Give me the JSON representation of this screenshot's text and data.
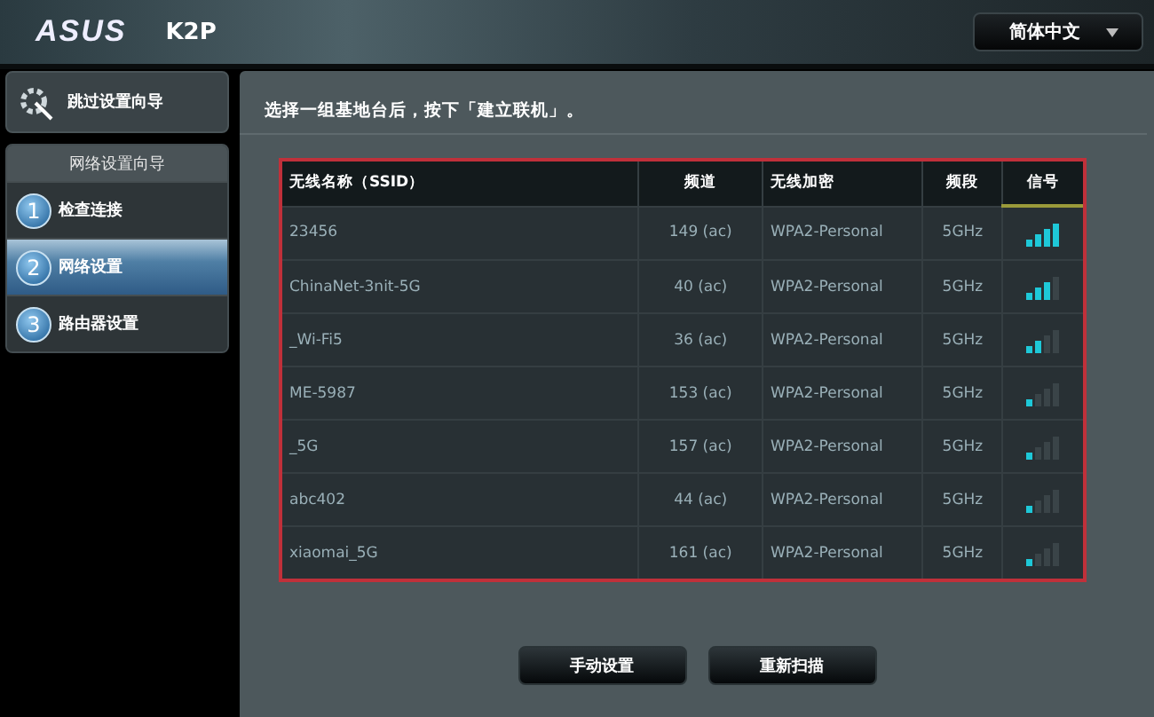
{
  "header": {
    "logo": "ASUS",
    "model": "K2P",
    "language": "简体中文"
  },
  "sidebar": {
    "skip_item": "跳过设置向导",
    "wizard_title": "网络设置向导",
    "steps": [
      {
        "number": "1",
        "label": "检查连接",
        "selected": false
      },
      {
        "number": "2",
        "label": "网络设置",
        "selected": true
      },
      {
        "number": "3",
        "label": "路由器设置",
        "selected": false
      }
    ]
  },
  "instruction": "选择一组基地台后，按下「建立联机」。",
  "table": {
    "columns": [
      "无线名称（SSID）",
      "频道",
      "无线加密",
      "频段",
      "信号"
    ],
    "rows": [
      {
        "ssid": "23456",
        "channel": "149 (ac)",
        "encryption": "WPA2-Personal",
        "band": "5GHz",
        "kind": "excellent"
      },
      {
        "ssid": "ChinaNet-3nit-5G",
        "channel": "40 (ac)",
        "encryption": "WPA2-Personal",
        "band": "5GHz",
        "kind": "good"
      },
      {
        "ssid": "_Wi-Fi5",
        "channel": "36 (ac)",
        "encryption": "WPA2-Personal",
        "band": "5GHz",
        "kind": "fair"
      },
      {
        "ssid": "ME-5987",
        "channel": "153 (ac)",
        "encryption": "WPA2-Personal",
        "band": "5GHz",
        "kind": "weak"
      },
      {
        "ssid": "_5G",
        "channel": "157 (ac)",
        "encryption": "WPA2-Personal",
        "band": "5GHz",
        "kind": "weak"
      },
      {
        "ssid": "abc402",
        "channel": "44 (ac)",
        "encryption": "WPA2-Personal",
        "band": "5GHz",
        "kind": "weak"
      },
      {
        "ssid": "xiaomai_5G",
        "channel": "161 (ac)",
        "encryption": "WPA2-Personal",
        "band": "5GHz",
        "kind": "weak"
      }
    ]
  },
  "buttons": [
    "手动设置",
    "重新扫描"
  ]
}
